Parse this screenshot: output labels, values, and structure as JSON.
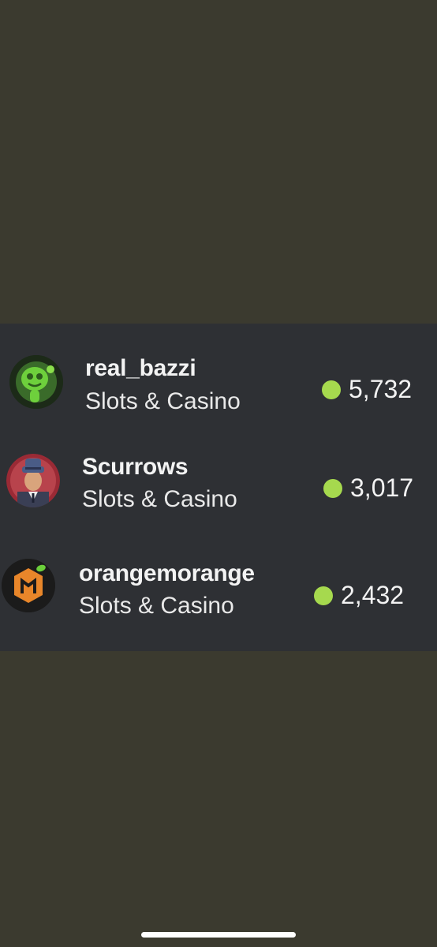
{
  "streams": [
    {
      "username": "real_bazzi",
      "category": "Slots & Casino",
      "viewers": "5,732",
      "avatar_icon": "green-alien-avatar"
    },
    {
      "username": "Scurrows",
      "category": "Slots & Casino",
      "viewers": "3,017",
      "avatar_icon": "man-in-hat-avatar"
    },
    {
      "username": "orangemorange",
      "category": "Slots & Casino",
      "viewers": "2,432",
      "avatar_icon": "orange-hexagon-logo-avatar"
    }
  ],
  "colors": {
    "background": "#3b3a2f",
    "panel": "#2e3034",
    "live_dot": "#a6d94e",
    "text": "#f3f3f3"
  }
}
